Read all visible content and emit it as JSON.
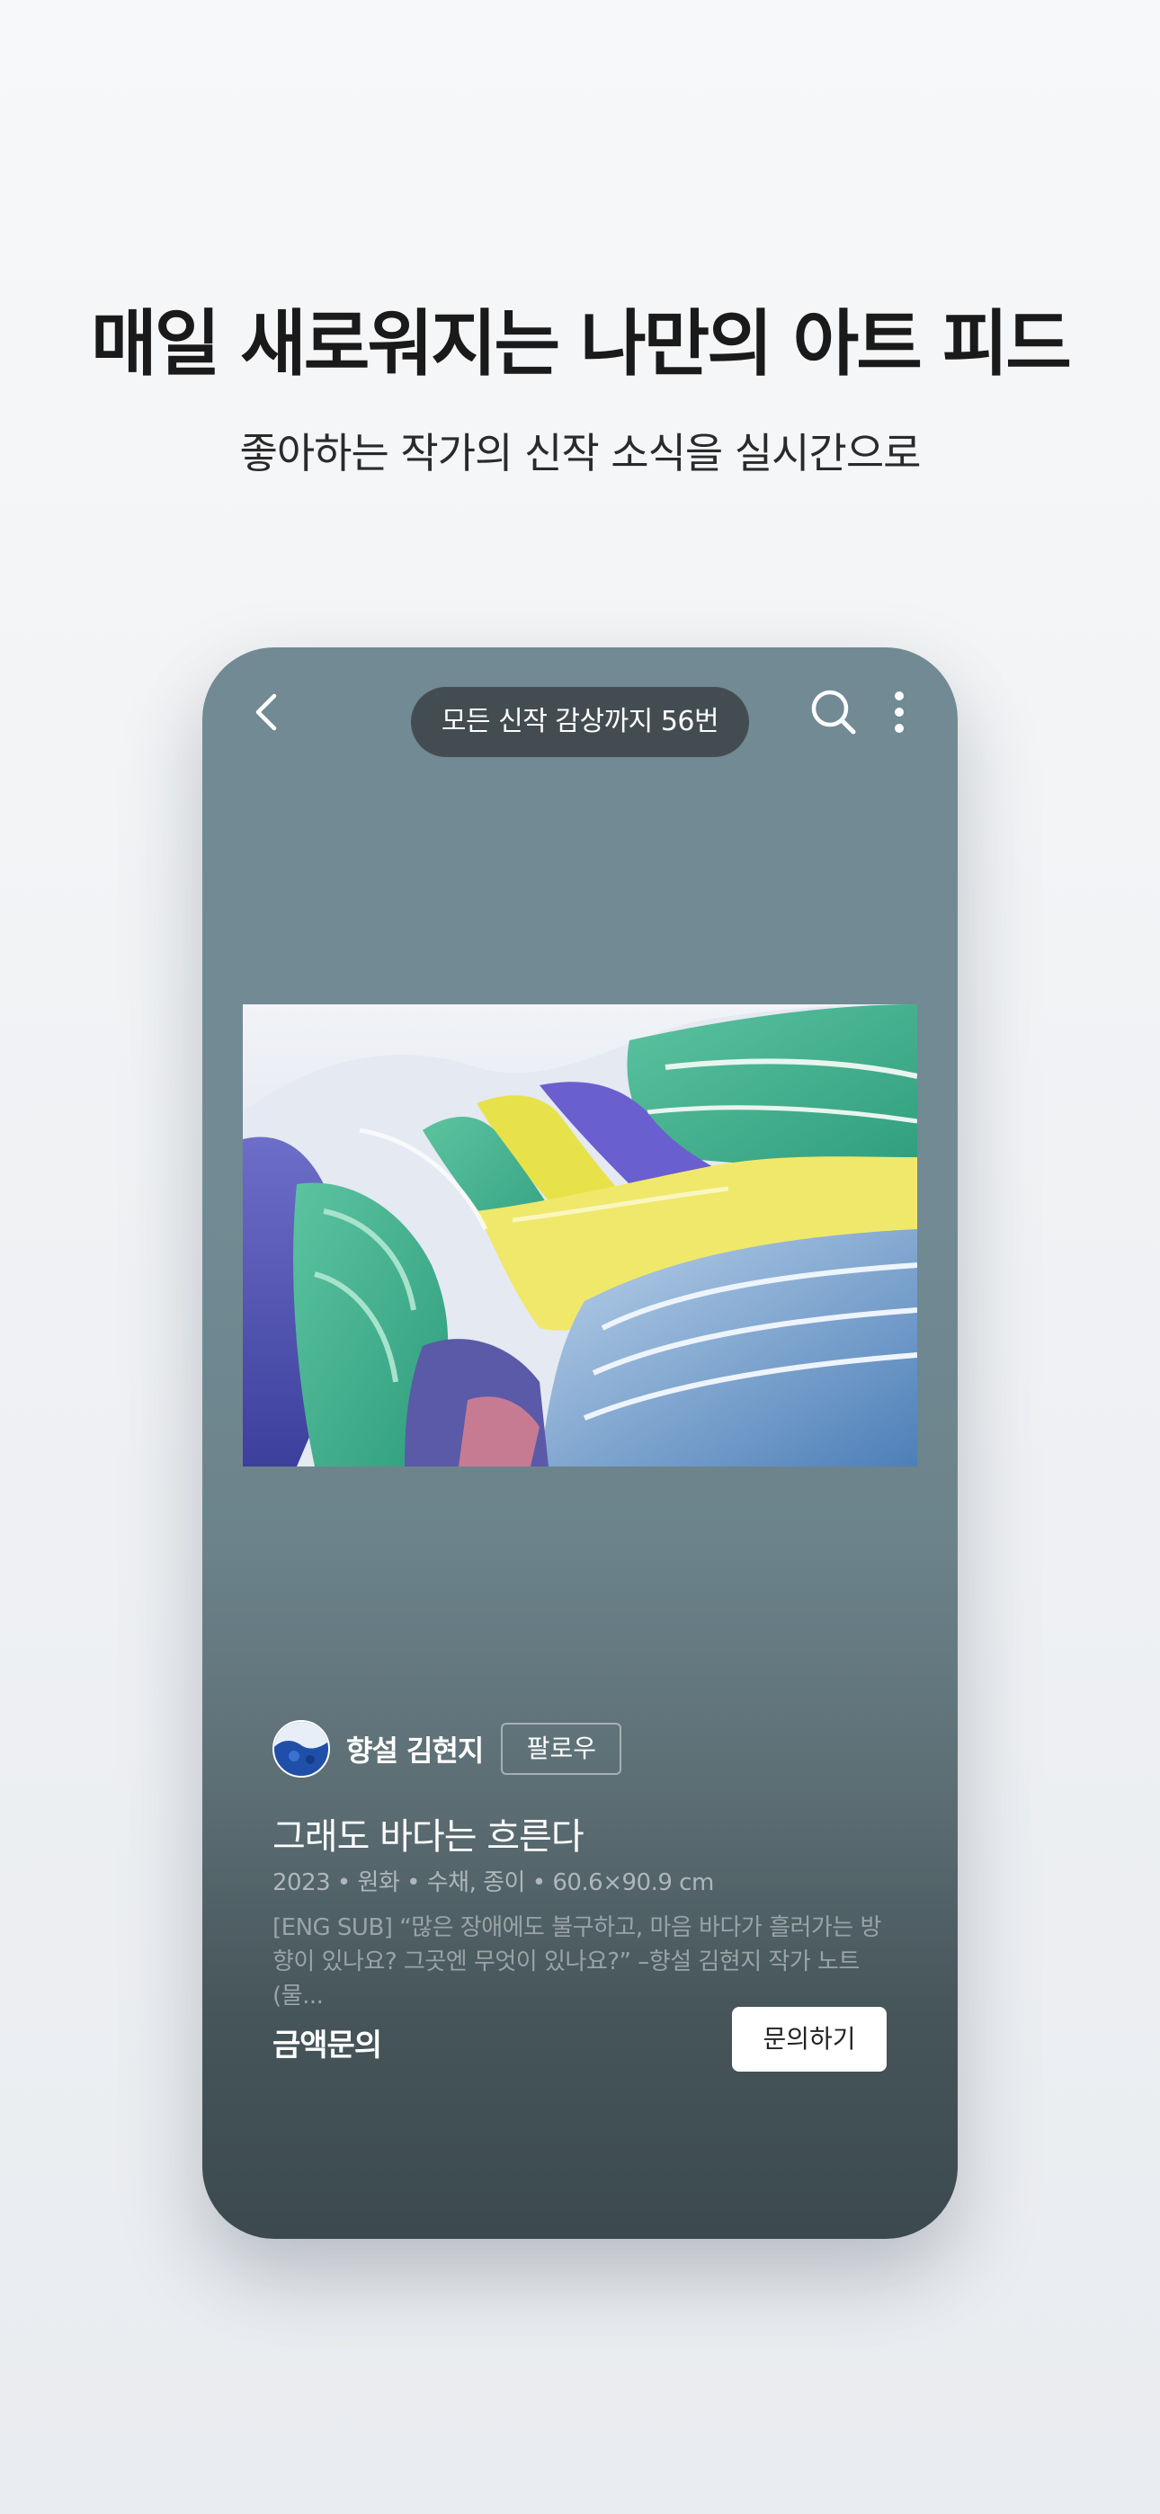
{
  "promo": {
    "headline": "매일 새로워지는 나만의 아트 피드",
    "subheadline": "좋아하는 작가의 신작 소식을 실시간으로"
  },
  "top_bar": {
    "progress_label": "모든 신작 감상까지 56번",
    "icons": [
      "chevron-left-icon",
      "search-icon",
      "more-vertical-icon"
    ]
  },
  "artwork": {
    "artist_name": "향설 김현지",
    "follow_label": "팔로우",
    "title": "그래도 바다는 흐른다",
    "meta": "2023 • 원화 • 수채, 종이 • 60.6×90.9 cm",
    "description": "[ENG SUB] “많은 장애에도 불구하고, 마음 바다가 흘러가는 방향이 있나요? 그곳엔 무엇이 있나요?” –향설 김현지 작가 노트 (물...",
    "price_label": "금액문의",
    "inquiry_label": "문의하기"
  },
  "colors": {
    "phone_bg_top": "#718a93",
    "phone_bg_bottom": "#3c4a4f",
    "pill_bg": "#434d51"
  }
}
